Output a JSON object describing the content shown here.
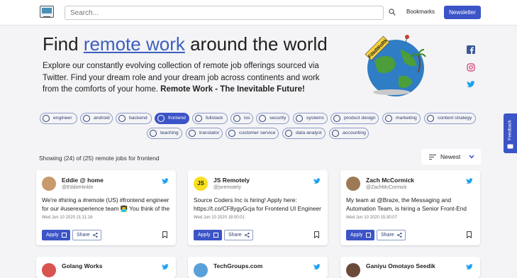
{
  "header": {
    "search_placeholder": "Search...",
    "bookmarks_label": "Bookmarks",
    "newsletter_label": "Newsletter"
  },
  "hero": {
    "title_before": "Find ",
    "title_link": "remote work",
    "title_after": " around the world",
    "desc_plain": "Explore our constantly evolving collection of remote job offerings sourced via Twitter. Find your dream role and your dream job across continents and work from the comforts of your home. ",
    "desc_bold": "Remote Work - The Inevitable Future!",
    "globe_label": "FiNdWoRk"
  },
  "social": [
    "facebook-icon",
    "instagram-icon",
    "twitter-icon"
  ],
  "feedback_label": "Feedback",
  "tags": [
    {
      "label": "engineer",
      "icon": "wrench-icon",
      "active": false
    },
    {
      "label": "android",
      "icon": "android-icon",
      "active": false
    },
    {
      "label": "backend",
      "icon": "gear-icon",
      "active": false
    },
    {
      "label": "frontend",
      "icon": "window-icon",
      "active": true
    },
    {
      "label": "fullstack",
      "icon": "code-icon",
      "active": false
    },
    {
      "label": "ios",
      "icon": "apple-icon",
      "active": false
    },
    {
      "label": "security",
      "icon": "shield-icon",
      "active": false
    },
    {
      "label": "systems",
      "icon": "server-icon",
      "active": false
    },
    {
      "label": "product design",
      "icon": "pencil-icon",
      "active": false
    },
    {
      "label": "marketing",
      "icon": "chart-line-icon",
      "active": false
    },
    {
      "label": "content strategy",
      "icon": "lightbulb-icon",
      "active": false
    },
    {
      "label": "teaching",
      "icon": "presentation-icon",
      "active": false
    },
    {
      "label": "translator",
      "icon": "translate-icon",
      "active": false
    },
    {
      "label": "customer service",
      "icon": "headset-icon",
      "active": false
    },
    {
      "label": "data analyst",
      "icon": "bar-chart-icon",
      "active": false
    },
    {
      "label": "accounting",
      "icon": "dollar-icon",
      "active": false
    }
  ],
  "results": {
    "showing_text": "Showing (24) of (25) remote jobs for frontend",
    "sort_value": "Newest"
  },
  "cards": [
    {
      "name": "Eddie @ home",
      "handle": "@EddieHinkle",
      "text": "We're #hiring a #remote (US) #frontend engineer for our #userexperience team 👨‍💻 You think of the",
      "date": "Wed Jun 10 2020 21:11:18",
      "avatar_color": "#c89a6b"
    },
    {
      "name": "JS Remotely",
      "handle": "@jsremotely",
      "text": "Source Coders Inc is hiring! Apply here: https://t.co/CF8ygyGcja for Frontend UI Engineer",
      "date": "Wed Jun 10 2020 18:00:01",
      "avatar_color": "#f7df1e",
      "avatar_text": "JS"
    },
    {
      "name": "Zach McCormick",
      "handle": "@ZachMcCormick",
      "text": "My team at @Braze, the Messaging and Automation Team, is hiring a Senior Front-End",
      "date": "Wed Jun 10 2020 15:30:07",
      "avatar_color": "#9b7a55"
    }
  ],
  "card_actions": {
    "apply_label": "Apply",
    "share_label": "Share"
  },
  "cards_row2": [
    {
      "name": "Golang Works",
      "avatar_color": "#d9534f"
    },
    {
      "name": "TechGroups.com",
      "avatar_color": "#5aa0d8"
    },
    {
      "name": "Ganiyu Omotayo Seedik",
      "avatar_color": "#6b4a3a"
    }
  ],
  "colors": {
    "accent": "#3b54c7",
    "twitter": "#1da1f2",
    "background": "#f4f4f6"
  }
}
